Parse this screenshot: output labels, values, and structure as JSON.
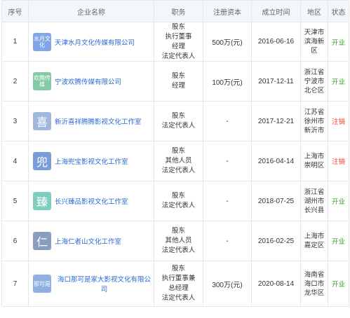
{
  "headers": {
    "no": "序号",
    "company": "企业名称",
    "role": "职务",
    "capital": "注册资本",
    "date": "成立时间",
    "area": "地区",
    "status": "状态"
  },
  "rows": [
    {
      "no": "1",
      "logo_text": "水月文化",
      "logo_color": "#7fa6e6",
      "logo_size": "small",
      "company": "天津水月文化传媒有限公司",
      "roles": [
        "股东",
        "执行董事",
        "经理",
        "法定代表人"
      ],
      "capital": "500万(元)",
      "date": "2016-06-16",
      "area": [
        "天津市",
        "滨海新",
        "区"
      ],
      "status": "开业",
      "status_color": "#3aa32b"
    },
    {
      "no": "2",
      "logo_text": "欢腾传媒",
      "logo_color": "#82cba5",
      "logo_size": "small",
      "company": "宁波欢腾传媒有限公司",
      "roles": [
        "股东",
        "经理"
      ],
      "capital": "100万(元)",
      "date": "2017-12-11",
      "area": [
        "浙江省",
        "宁波市",
        "北仑区"
      ],
      "status": "开业",
      "status_color": "#3aa32b"
    },
    {
      "no": "3",
      "logo_text": "喜",
      "logo_color": "#9fb8dc",
      "logo_size": "big",
      "company": "新沂喜祥腾腾影视文化工作室",
      "roles": [
        "股东",
        "法定代表人"
      ],
      "capital": "-",
      "date": "2017-12-21",
      "area": [
        "江苏省",
        "徐州市",
        "新沂市"
      ],
      "status": "注销",
      "status_color": "#e8452b"
    },
    {
      "no": "4",
      "logo_text": "兜",
      "logo_color": "#7a9dd8",
      "logo_size": "big",
      "company": "上海兜宝影视文化工作室",
      "roles": [
        "股东",
        "其他人员",
        "法定代表人"
      ],
      "capital": "-",
      "date": "2016-04-14",
      "area": [
        "上海市",
        "崇明区"
      ],
      "status": "注销",
      "status_color": "#e8452b"
    },
    {
      "no": "5",
      "logo_text": "臻",
      "logo_color": "#7fcfc0",
      "logo_size": "big",
      "company": "长兴臻品影视文化工作室",
      "roles": [
        "股东",
        "法定代表人"
      ],
      "capital": "-",
      "date": "2018-07-25",
      "area": [
        "浙江省",
        "湖州市",
        "长兴县"
      ],
      "status": "开业",
      "status_color": "#3aa32b"
    },
    {
      "no": "6",
      "logo_text": "仁",
      "logo_color": "#8a9dbf",
      "logo_size": "big",
      "company": "上海仁者山文化工作室",
      "roles": [
        "股东",
        "其他人员",
        "法定代表人"
      ],
      "capital": "-",
      "date": "2016-02-25",
      "area": [
        "上海市",
        "嘉定区"
      ],
      "status": "开业",
      "status_color": "#3aa32b"
    },
    {
      "no": "7",
      "logo_text": "那可是",
      "logo_color": "#8fb0e0",
      "logo_size": "small",
      "company": "海口那可是家大影视文化有限公司",
      "roles": [
        "股东",
        "执行董事兼",
        "总经理",
        "法定代表人"
      ],
      "capital": "300万(元)",
      "date": "2020-08-14",
      "area": [
        "海南省",
        "海口市",
        "龙华区"
      ],
      "status": "开业",
      "status_color": "#3aa32b"
    }
  ]
}
